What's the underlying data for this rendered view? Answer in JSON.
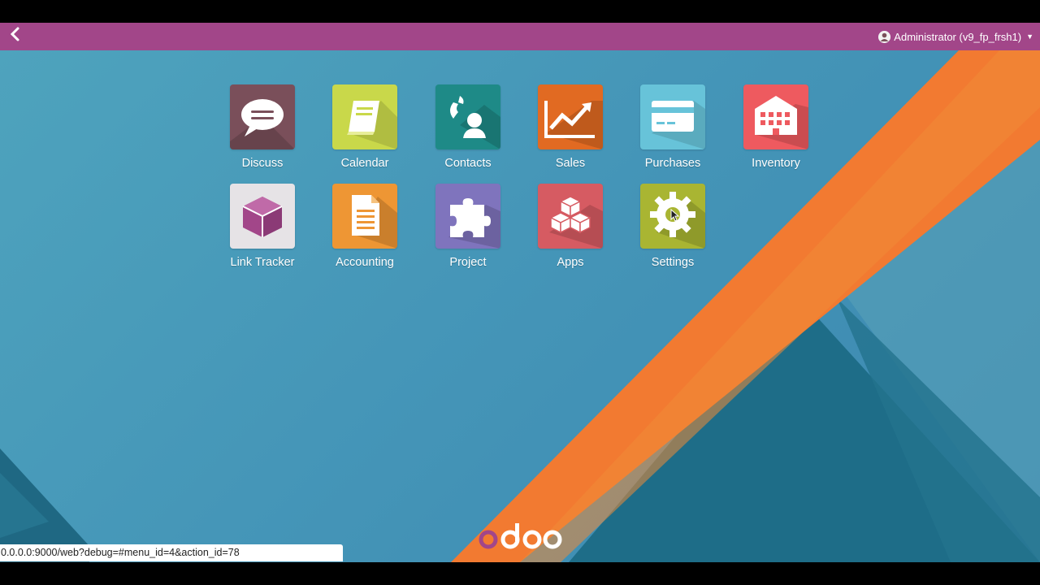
{
  "user_menu": {
    "label": "Administrator (v9_fp_frsh1)",
    "avatar_icon": "user-avatar-icon"
  },
  "apps": [
    {
      "label": "Discuss",
      "color": "#7a4f5a",
      "icon": "speech-bubble-icon"
    },
    {
      "label": "Calendar",
      "color": "#c9d84a",
      "icon": "book-icon"
    },
    {
      "label": "Contacts",
      "color": "#1e8a87",
      "icon": "phone-person-icon"
    },
    {
      "label": "Sales",
      "color": "#e16a22",
      "icon": "trend-chart-icon"
    },
    {
      "label": "Purchases",
      "color": "#67c3d9",
      "icon": "credit-card-icon"
    },
    {
      "label": "Inventory",
      "color": "#ee5a5f",
      "icon": "warehouse-icon"
    },
    {
      "label": "Link Tracker",
      "color": "#e6e3e6",
      "icon": "cube-icon"
    },
    {
      "label": "Accounting",
      "color": "#ee9634",
      "icon": "document-icon"
    },
    {
      "label": "Project",
      "color": "#7f74bd",
      "icon": "puzzle-icon"
    },
    {
      "label": "Apps",
      "color": "#d65b62",
      "icon": "boxes-icon"
    },
    {
      "label": "Settings",
      "color": "#a9b532",
      "icon": "gear-icon"
    }
  ],
  "logo": "odoo",
  "status_bar": {
    "url": "0.0.0.0:9000/web?debug=#menu_id=4&action_id=78"
  },
  "colors": {
    "navbar": "#a24689",
    "accent_stripe": "#f27a31"
  }
}
